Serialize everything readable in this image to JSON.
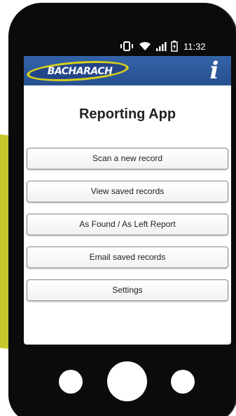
{
  "status_bar": {
    "time": "11:32"
  },
  "header": {
    "brand": "BACHARACH",
    "info_label": "i"
  },
  "app": {
    "title": "Reporting App"
  },
  "menu": {
    "items": [
      {
        "label": "Scan a new record"
      },
      {
        "label": "View saved records"
      },
      {
        "label": "As Found / As Left Report"
      },
      {
        "label": "Email saved records"
      },
      {
        "label": "Settings"
      }
    ]
  },
  "colors": {
    "header_blue": "#2e5a9c",
    "brand_yellow": "#d8cf1c",
    "backdrop_green": "#c5c82a",
    "phone_black": "#0b0b0b"
  }
}
